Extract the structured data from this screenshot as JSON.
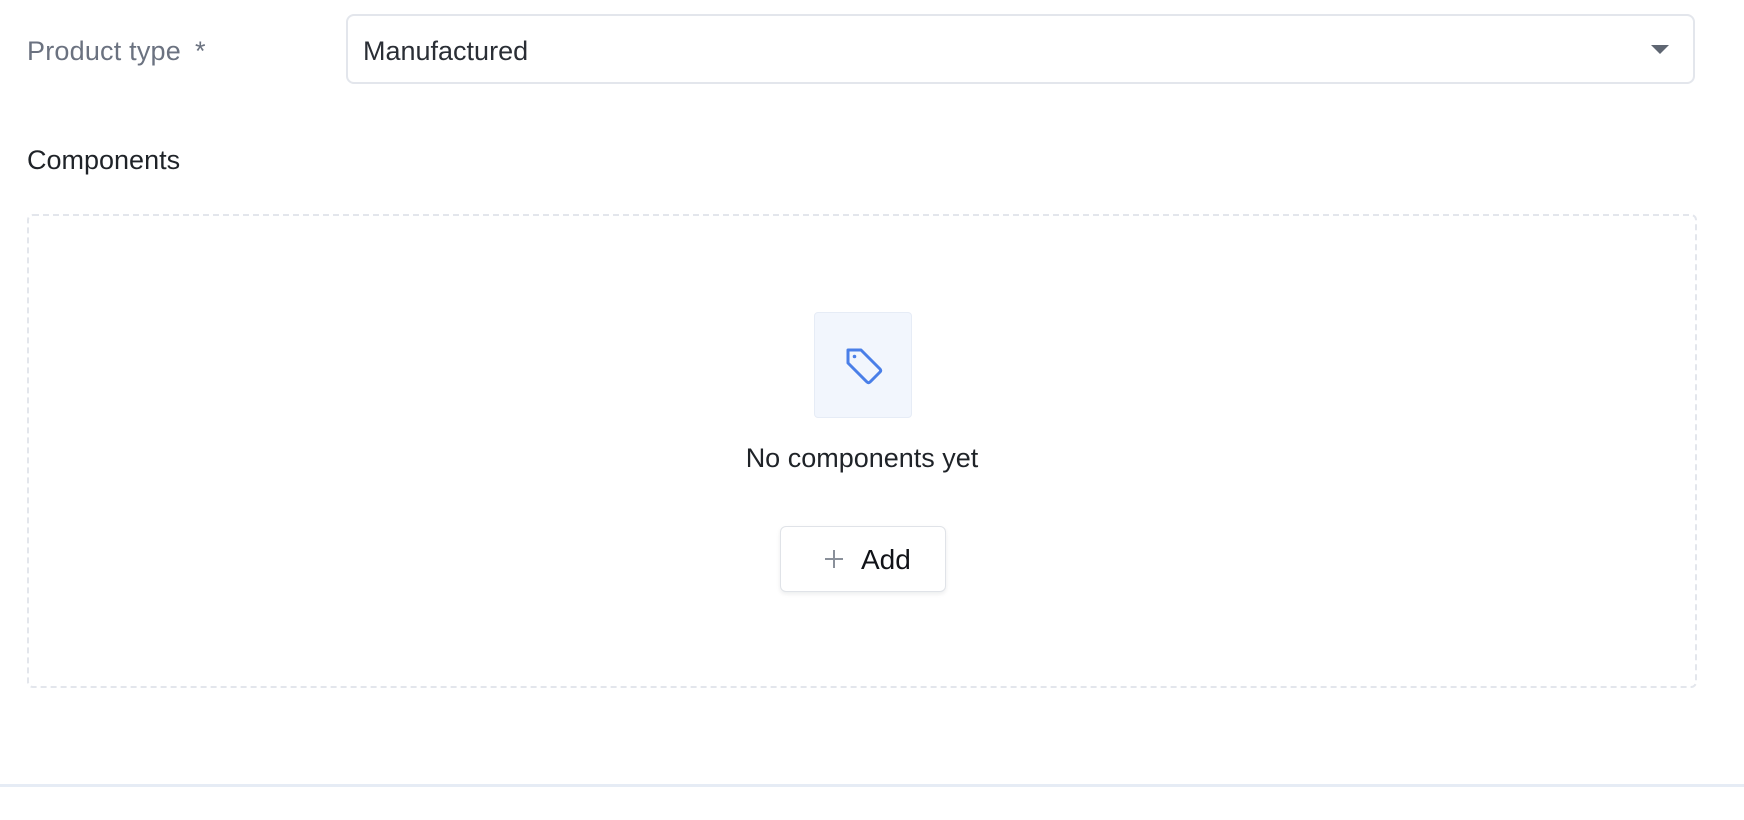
{
  "product_type": {
    "label": "Product type",
    "required_marker": "*",
    "selected_value": "Manufactured",
    "chevron_icon": "chevron-down-icon"
  },
  "components": {
    "section_title": "Components",
    "empty_state": {
      "icon": "tag-icon",
      "icon_color": "#4a7fe8",
      "message": "No components yet"
    },
    "add_button": {
      "icon": "plus-icon",
      "label": "Add"
    }
  }
}
